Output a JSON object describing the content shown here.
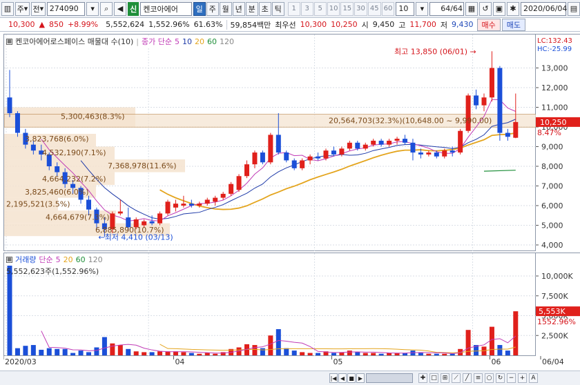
{
  "toolbar": {
    "type_code": "주",
    "market": "전",
    "code": "274090",
    "sin_label": "신",
    "stock_name": "켄코아에어",
    "periods": [
      "일",
      "주",
      "월",
      "년",
      "분",
      "초",
      "틱"
    ],
    "active_period": 0,
    "intervals": [
      "1",
      "3",
      "5",
      "10",
      "15",
      "30",
      "45",
      "60"
    ],
    "interval_value": "10",
    "count": "64",
    "count_total": "/64",
    "date": "2020/06/04"
  },
  "quote": {
    "price": "10,300",
    "change": "850",
    "change_pct": "+8.99%",
    "volume": "5,552,624",
    "volume_pct": "1,552.96%",
    "turnover_ratio": "61.63%",
    "amount": "59,854백만",
    "best_ask_label": "최우선",
    "best_ask": "10,300",
    "best_bid": "10,250",
    "open_label": "시",
    "open": "9,450",
    "high_label": "고",
    "high": "11,700",
    "low_label": "저",
    "low": "9,430",
    "buy_label": "매수",
    "sell_label": "매도"
  },
  "price_pane": {
    "legend_title": "켄코아에어로스페이스 매물대 수(10)",
    "legend_close": "종가 단순",
    "ma_periods": [
      "5",
      "10",
      "20",
      "60",
      "120"
    ],
    "lc_label": "LC:132.43",
    "hc_label": "HC:-25.99",
    "high_note": "최고 13,850 (06/01)",
    "low_note": "최저 4,410 (03/13)",
    "current_price": "10,250",
    "current_pct": "8.47%",
    "profile_labels": [
      "5,300,463(8.3%)",
      "20,564,703(32.3%)(10,648.00 ~ 9,990.00)",
      "3,823,768(6.0%)",
      "4,532,190(7.1%)",
      "7,368,978(11.6%)",
      "4,664,232(7.2%)",
      "3,825,460(6.0%)",
      "2,195,521(3.5%)",
      "4,664,679(7.3%)",
      "6,885,890(10.7%)"
    ]
  },
  "volume_pane": {
    "legend_title": "거래량",
    "legend_close": "단순",
    "ma_periods": [
      "5",
      "20",
      "60",
      "120"
    ],
    "max_label": "5,552,623주(1,552.96%)",
    "current_volume": "5,553K",
    "current_pct": "1552.96%"
  },
  "x_labels": [
    "2020/03",
    "04",
    "05",
    "06",
    "06/04"
  ],
  "colors": {
    "up": "#e0201b",
    "down": "#1b4fd8",
    "ma5": "#c03bb6",
    "ma10": "#1e3aa8",
    "ma20": "#e4a51e",
    "ma60": "#1f8f3a",
    "profile": "#f5e3cf"
  },
  "chart_data": [
    {
      "type": "candlestick",
      "title": "켄코아에어로스페이스",
      "ylim": [
        4000,
        14000
      ],
      "y_ticks": [
        4000,
        5000,
        6000,
        7000,
        8000,
        9000,
        10000,
        11000,
        12000,
        13000
      ],
      "y_tick_labels": [
        "4,000",
        "5,000",
        "6,000",
        "7,000",
        "8,000",
        "9,000",
        "10,000",
        "11,000",
        "12,000",
        "13,000"
      ],
      "x_labels": [
        "2020/03",
        "04",
        "05",
        "06"
      ],
      "ohlc": [
        [
          11500,
          12900,
          10500,
          10700
        ],
        [
          10700,
          10800,
          9500,
          9700
        ],
        [
          9700,
          9900,
          8900,
          9100
        ],
        [
          9100,
          9300,
          8600,
          8800
        ],
        [
          8800,
          9100,
          8300,
          8600
        ],
        [
          8600,
          8700,
          7800,
          8000
        ],
        [
          8000,
          8200,
          7500,
          7700
        ],
        [
          7700,
          7900,
          6900,
          7100
        ],
        [
          7100,
          7300,
          6600,
          6900
        ],
        [
          6900,
          7000,
          6100,
          6300
        ],
        [
          6300,
          6500,
          5500,
          5800
        ],
        [
          5800,
          5900,
          4800,
          5100
        ],
        [
          5100,
          5400,
          4410,
          4800
        ],
        [
          4800,
          5700,
          4600,
          5600
        ],
        [
          5600,
          6300,
          5500,
          5700
        ],
        [
          5400,
          5900,
          4700,
          4900
        ],
        [
          4900,
          5400,
          4800,
          5300
        ],
        [
          5000,
          5300,
          4900,
          5200
        ],
        [
          5200,
          5500,
          5000,
          5100
        ],
        [
          5100,
          5700,
          5000,
          5600
        ],
        [
          5600,
          6300,
          5500,
          6200
        ],
        [
          5900,
          6300,
          5700,
          6100
        ],
        [
          6000,
          6500,
          5900,
          6100
        ],
        [
          6100,
          6300,
          5900,
          6000
        ],
        [
          6000,
          6200,
          5900,
          6100
        ],
        [
          6100,
          6400,
          6000,
          6300
        ],
        [
          6200,
          6500,
          6000,
          6400
        ],
        [
          6400,
          6700,
          6300,
          6600
        ],
        [
          6600,
          7200,
          6500,
          7100
        ],
        [
          6800,
          7600,
          6700,
          7500
        ],
        [
          7500,
          8300,
          7400,
          8100
        ],
        [
          8100,
          8800,
          7900,
          8700
        ],
        [
          8700,
          8800,
          8100,
          8200
        ],
        [
          8200,
          9700,
          8100,
          9600
        ],
        [
          9600,
          10700,
          8600,
          8700
        ],
        [
          8700,
          8800,
          8200,
          8300
        ],
        [
          8300,
          8400,
          7800,
          7900
        ],
        [
          7900,
          8400,
          7800,
          8300
        ],
        [
          8300,
          8600,
          8100,
          8500
        ],
        [
          8500,
          8700,
          8300,
          8400
        ],
        [
          8400,
          8900,
          8300,
          8800
        ],
        [
          8800,
          9000,
          8500,
          8600
        ],
        [
          8600,
          9000,
          8500,
          8900
        ],
        [
          8900,
          9300,
          8800,
          9200
        ],
        [
          9200,
          9300,
          8800,
          8900
        ],
        [
          8900,
          9200,
          8800,
          9100
        ],
        [
          9100,
          9400,
          9000,
          9300
        ],
        [
          9300,
          9400,
          9000,
          9100
        ],
        [
          9100,
          9400,
          9000,
          9300
        ],
        [
          9300,
          9500,
          9100,
          9400
        ],
        [
          9400,
          9600,
          9100,
          9200
        ],
        [
          9200,
          9400,
          8300,
          8700
        ],
        [
          8700,
          8900,
          8400,
          8600
        ],
        [
          8600,
          8800,
          8500,
          8700
        ],
        [
          8700,
          8800,
          8400,
          8500
        ],
        [
          8500,
          8900,
          8400,
          8800
        ],
        [
          8800,
          9000,
          8500,
          8700
        ],
        [
          8700,
          9900,
          8600,
          9800
        ],
        [
          9800,
          11700,
          9700,
          11600
        ],
        [
          11600,
          11900,
          10900,
          11100
        ],
        [
          11100,
          11700,
          10800,
          11500
        ],
        [
          11500,
          13850,
          11300,
          13000
        ],
        [
          13000,
          13100,
          9300,
          9700
        ],
        [
          9700,
          9900,
          9300,
          9500
        ],
        [
          9450,
          11700,
          9430,
          10250
        ]
      ]
    },
    {
      "type": "bar",
      "title": "거래량",
      "ylim": [
        0,
        12000000
      ],
      "y_ticks": [
        2500000,
        5000000,
        7500000,
        10000000
      ],
      "y_tick_labels": [
        "2,500K",
        "5,000K",
        "7,500K",
        "10,000K"
      ],
      "values": [
        11300000,
        900000,
        1200000,
        1300000,
        700000,
        900000,
        800000,
        800000,
        300000,
        600000,
        400000,
        1000000,
        2300000,
        1500000,
        1300000,
        800000,
        500000,
        400000,
        400000,
        500000,
        500000,
        500000,
        400000,
        300000,
        200000,
        300000,
        200000,
        400000,
        800000,
        1000000,
        1400000,
        1300000,
        900000,
        2500000,
        3300000,
        900000,
        600000,
        400000,
        300000,
        300000,
        500000,
        300000,
        400000,
        600000,
        400000,
        300000,
        300000,
        200000,
        300000,
        300000,
        300000,
        600000,
        300000,
        200000,
        200000,
        200000,
        200000,
        800000,
        3200000,
        1300000,
        1100000,
        3600000,
        1300000,
        600000,
        5552623
      ]
    }
  ]
}
